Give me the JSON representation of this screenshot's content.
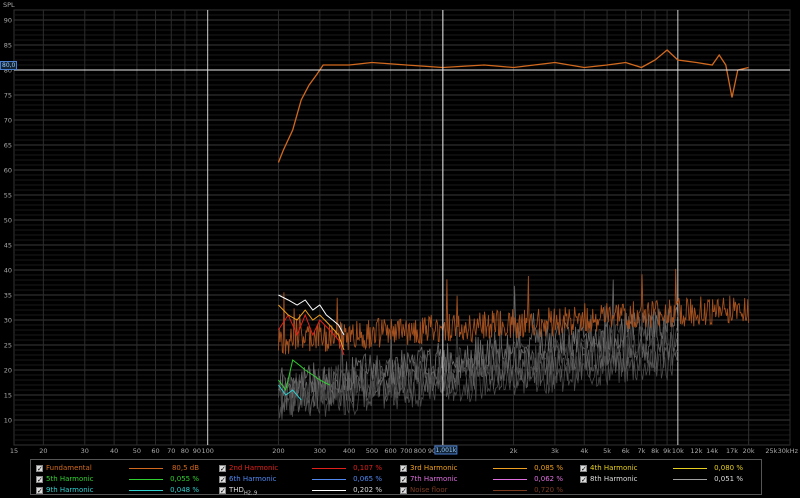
{
  "axis": {
    "y_title": "SPL",
    "x_unit_label": "30kHz"
  },
  "y_ticks": [
    90,
    85,
    80,
    75,
    70,
    65,
    60,
    55,
    50,
    45,
    40,
    35,
    30,
    25,
    20,
    15,
    10
  ],
  "x_ticks": [
    {
      "v": 15,
      "t": "15"
    },
    {
      "v": 20,
      "t": "20"
    },
    {
      "v": 30,
      "t": "30"
    },
    {
      "v": 40,
      "t": "40"
    },
    {
      "v": 50,
      "t": "50"
    },
    {
      "v": 60,
      "t": "60"
    },
    {
      "v": 70,
      "t": "70"
    },
    {
      "v": 80,
      "t": "80"
    },
    {
      "v": 90,
      "t": "90"
    },
    {
      "v": 100,
      "t": "100"
    },
    {
      "v": 200,
      "t": "200"
    },
    {
      "v": 300,
      "t": "300"
    },
    {
      "v": 400,
      "t": "400"
    },
    {
      "v": 500,
      "t": "500"
    },
    {
      "v": 600,
      "t": "600"
    },
    {
      "v": 700,
      "t": "700"
    },
    {
      "v": 800,
      "t": "800"
    },
    {
      "v": 900,
      "t": "90"
    },
    {
      "v": 2000,
      "t": "2k"
    },
    {
      "v": 3000,
      "t": "3k"
    },
    {
      "v": 4000,
      "t": "4k"
    },
    {
      "v": 5000,
      "t": "5k"
    },
    {
      "v": 6000,
      "t": "6k"
    },
    {
      "v": 7000,
      "t": "7k"
    },
    {
      "v": 8000,
      "t": "8k"
    },
    {
      "v": 9000,
      "t": "9k"
    },
    {
      "v": 10000,
      "t": "10k"
    },
    {
      "v": 12000,
      "t": "12k"
    },
    {
      "v": 14000,
      "t": "14k"
    },
    {
      "v": 17000,
      "t": "17k"
    },
    {
      "v": 20000,
      "t": "20k"
    },
    {
      "v": 25000,
      "t": "25k"
    }
  ],
  "cursor": {
    "freq_label": "1,001k",
    "level_label": "80,0",
    "freq": 1001,
    "level": 80.0
  },
  "legend": [
    {
      "label": "Fundamental",
      "color": "#d2691e",
      "value": "80,5 dB",
      "checked": true
    },
    {
      "label": "2nd Harmonic",
      "color": "#e0201a",
      "value": "0,107 %",
      "checked": true
    },
    {
      "label": "3rd Harmonic",
      "color": "#f0a020",
      "value": "0,085 %",
      "checked": true
    },
    {
      "label": "4th Harmonic",
      "color": "#e8d020",
      "value": "0,080 %",
      "checked": true
    },
    {
      "label": "5th Harmonic",
      "color": "#30d030",
      "value": "0,055 %",
      "checked": true
    },
    {
      "label": "6th Harmonic",
      "color": "#5088f0",
      "value": "0,065 %",
      "checked": true
    },
    {
      "label": "7th Harmonic",
      "color": "#e070e0",
      "value": "0,062 %",
      "checked": true
    },
    {
      "label": "8th Harmonic",
      "color": "#a0a0a0",
      "value": "0,051 %",
      "checked": true
    },
    {
      "label": "9th Harmonic",
      "color": "#30d0d0",
      "value": "0,048 %",
      "checked": true
    },
    {
      "label": "THD",
      "sub": "H2..9",
      "color": "#ffffff",
      "value": "0,202 %",
      "checked": true
    },
    {
      "label": "Noise floor",
      "color": "#7a3a20",
      "value": "0,720 %",
      "checked": true
    }
  ],
  "chart_data": {
    "type": "line",
    "x_scale": "log",
    "xlim": [
      15,
      30000
    ],
    "ylim": [
      5,
      92
    ],
    "series": [
      {
        "name": "Fundamental",
        "x": [
          200,
          210,
          230,
          250,
          270,
          290,
          310,
          350,
          400,
          500,
          700,
          1000,
          1500,
          2000,
          3000,
          4000,
          5000,
          6000,
          7000,
          8000,
          9000,
          10000,
          12000,
          14000,
          15000,
          16000,
          17000,
          18000,
          20000
        ],
        "y": [
          61.5,
          64,
          68,
          74,
          77,
          79,
          81,
          81,
          81,
          81.5,
          81,
          80.5,
          81,
          80.5,
          81.5,
          80.5,
          81,
          81.5,
          80.5,
          82,
          84,
          82,
          81.5,
          81,
          83,
          81,
          74.5,
          80,
          80.5
        ]
      },
      {
        "name": "2nd Harmonic",
        "x": [
          200,
          220,
          240,
          260,
          280,
          300,
          330,
          360,
          380
        ],
        "y": [
          28,
          31,
          27,
          31,
          27,
          30,
          28,
          26,
          23
        ]
      },
      {
        "name": "3rd Harmonic",
        "x": [
          200,
          220,
          240,
          260,
          280,
          300,
          330,
          360,
          380
        ],
        "y": [
          33,
          31,
          30,
          32,
          30,
          31,
          29,
          27,
          24
        ]
      },
      {
        "name": "THD",
        "x": [
          200,
          220,
          240,
          260,
          280,
          300,
          320,
          340,
          360,
          380
        ],
        "y": [
          35,
          34,
          33,
          34,
          32,
          33,
          31,
          30,
          29,
          27
        ]
      },
      {
        "name": "5th Harmonic",
        "x": [
          200,
          215,
          230,
          245,
          260,
          280,
          300,
          330
        ],
        "y": [
          18,
          16,
          22,
          21,
          20,
          19,
          18,
          17
        ]
      },
      {
        "name": "9th Harmonic",
        "x": [
          200,
          215,
          230,
          250
        ],
        "y": [
          17,
          15,
          16,
          14
        ]
      }
    ]
  }
}
